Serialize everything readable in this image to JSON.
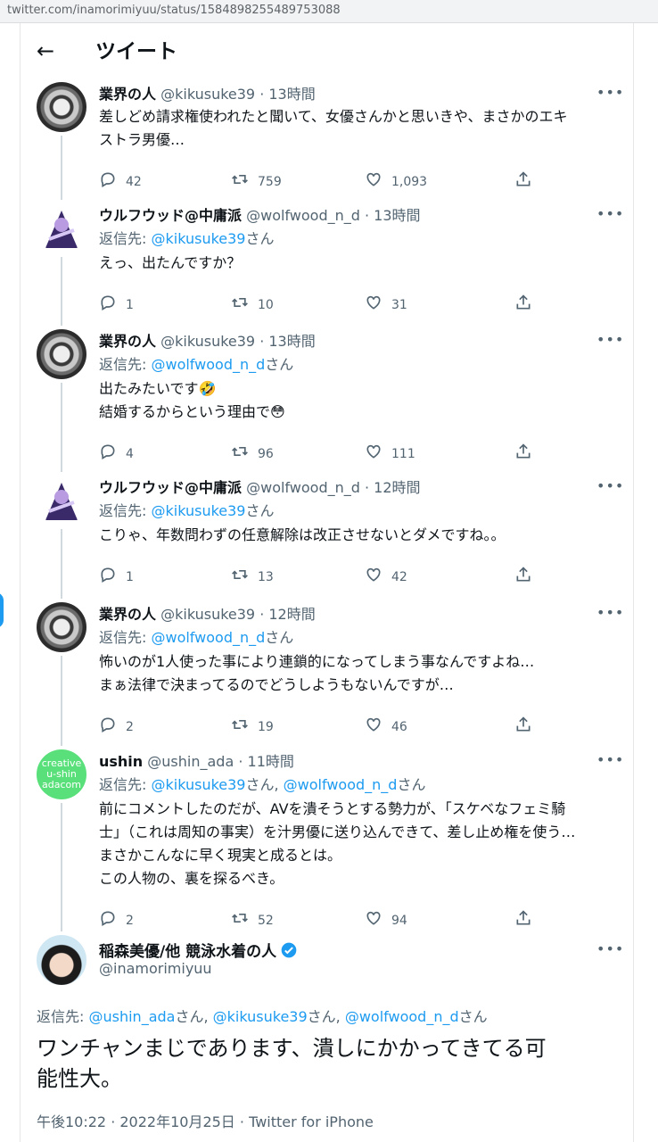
{
  "browser": {
    "url": "twitter.com/inamorimiyuu/status/1584898255489753088"
  },
  "header": {
    "back_icon": "←",
    "title": "ツイート"
  },
  "colors": {
    "link": "#1d9bf0",
    "muted": "#536471",
    "text": "#0f1419",
    "thread_line": "#cfd9de"
  },
  "tweets": [
    {
      "name": "業界の人",
      "handle": "@kikusuke39",
      "sep": " · ",
      "time": "13時間",
      "reply_prefix": "",
      "reply_links": [],
      "lines": [
        "差しどめ請求権使われたと聞いて、女優さんかと思いきや、まさかのエキ",
        "ストラ男優…"
      ],
      "counts": {
        "reply": "42",
        "retweet": "759",
        "like": "1,093"
      }
    },
    {
      "name": "ウルフウッド@中庸派",
      "handle": "@wolfwood_n_d",
      "sep": " · ",
      "time": "13時間",
      "reply_prefix": "返信先: ",
      "reply_links": [
        "@kikusuke39"
      ],
      "reply_suffix": "さん",
      "lines": [
        "えっ、出たんですか？"
      ],
      "counts": {
        "reply": "1",
        "retweet": "10",
        "like": "31"
      }
    },
    {
      "name": "業界の人",
      "handle": "@kikusuke39",
      "sep": " · ",
      "time": "13時間",
      "reply_prefix": "返信先: ",
      "reply_links": [
        "@wolfwood_n_d"
      ],
      "reply_suffix": "さん",
      "lines": [
        "出たみたいです🤣",
        "結婚するからという理由で😳"
      ],
      "counts": {
        "reply": "4",
        "retweet": "96",
        "like": "111"
      }
    },
    {
      "name": "ウルフウッド@中庸派",
      "handle": "@wolfwood_n_d",
      "sep": " · ",
      "time": "12時間",
      "reply_prefix": "返信先: ",
      "reply_links": [
        "@kikusuke39"
      ],
      "reply_suffix": "さん",
      "lines": [
        "こりゃ、年数問わずの任意解除は改正させないとダメですね。。"
      ],
      "counts": {
        "reply": "1",
        "retweet": "13",
        "like": "42"
      }
    },
    {
      "name": "業界の人",
      "handle": "@kikusuke39",
      "sep": " · ",
      "time": "12時間",
      "reply_prefix": "返信先: ",
      "reply_links": [
        "@wolfwood_n_d"
      ],
      "reply_suffix": "さん",
      "lines": [
        "怖いのが1人使った事により連鎖的になってしまう事なんですよね…",
        "まぁ法律で決まってるのでどうしようもないんですが…"
      ],
      "counts": {
        "reply": "2",
        "retweet": "19",
        "like": "46"
      }
    },
    {
      "name": "ushin",
      "handle": "@ushin_ada",
      "sep": " · ",
      "time": "11時間",
      "reply_prefix": "返信先: ",
      "reply_links": [
        "@kikusuke39",
        "@wolfwood_n_d"
      ],
      "reply_mid": "さん, ",
      "reply_suffix": "さん",
      "lines": [
        "前にコメントしたのだが、AVを潰そうとする勢力が、「スケベなフェミ騎",
        "士」（これは周知の事実）を汁男優に送り込んできて、差し止め権を使う…",
        "まさかこんなに早く現実と成るとは。",
        "この人物の、裏を探るべき。"
      ],
      "counts": {
        "reply": "2",
        "retweet": "52",
        "like": "94"
      },
      "avatar_text": [
        "creative",
        "u-shin",
        "adacom"
      ]
    }
  ],
  "main_tweet": {
    "name": "稲森美優/他 競泳水着の人",
    "handle": "@inamorimiyuu",
    "reply_prefix": "返信先: ",
    "reply_links": [
      "@ushin_ada",
      "@kikusuke39",
      "@wolfwood_n_d"
    ],
    "reply_joiner": "さん, ",
    "reply_suffix": "さん",
    "lines": [
      "ワンチャンまじであります、潰しにかかってきてる可",
      "能性大。"
    ],
    "timestamp": "午後10:22 · 2022年10月25日 · Twitter for iPhone"
  },
  "icons": {
    "more": "more-icon",
    "reply": "reply-icon",
    "retweet": "retweet-icon",
    "like": "heart-icon",
    "share": "share-icon",
    "verified": "verified-badge-icon"
  }
}
